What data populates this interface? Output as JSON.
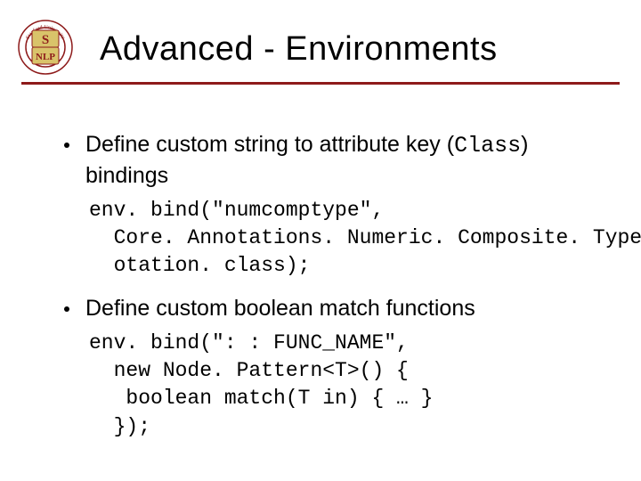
{
  "title": "Advanced - Environments",
  "logo": {
    "outer_text": "Stanford University",
    "inner_top": "S",
    "inner_bottom": "NLP"
  },
  "colors": {
    "accent": "#8d1a1a"
  },
  "bullets": [
    {
      "text_before": "Define custom string to attribute key (",
      "mono": "Class",
      "text_after": ") bindings",
      "code": "env. bind(\"numcomptype\",\n  Core. Annotations. Numeric. Composite. Type. Ann\n  otation. class);"
    },
    {
      "text_before": "Define custom boolean match functions",
      "mono": "",
      "text_after": "",
      "code": "env. bind(\": : FUNC_NAME\",\n  new Node. Pattern<T>() {\n   boolean match(T in) { … }\n  });"
    }
  ]
}
